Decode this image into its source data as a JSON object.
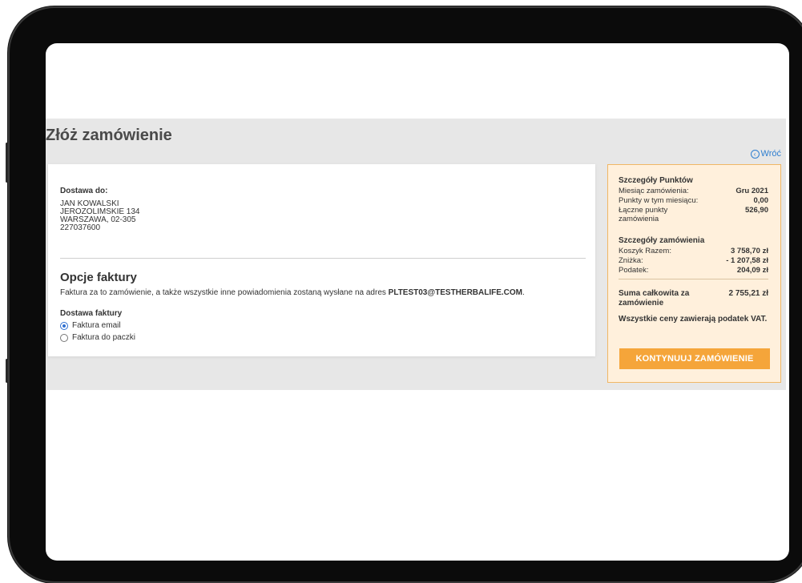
{
  "page": {
    "title": "Złóż zamówienie",
    "back_link": "Wróć"
  },
  "shipping": {
    "title": "Dostawa do:",
    "lines": [
      "JAN KOWALSKI",
      "JEROZOLIMSKIE 134",
      "WARSZAWA, 02-305",
      "227037600"
    ]
  },
  "invoice": {
    "title": "Opcje faktury",
    "description_prefix": "Faktura za to zamówienie, a także wszystkie inne powiadomienia zostaną wysłane na adres",
    "email": "PLTEST03@TESTHERBALIFE.COM",
    "description_suffix": ".",
    "delivery_label": "Dostawa faktury",
    "options": [
      {
        "label": "Faktura email",
        "selected": true
      },
      {
        "label": "Faktura do paczki",
        "selected": false
      }
    ]
  },
  "summary": {
    "points_title": "Szczegóły Punktów",
    "points_rows": [
      {
        "label": "Miesiąc zamówienia:",
        "value": "Gru 2021"
      },
      {
        "label": "Punkty w tym miesiącu:",
        "value": "0,00"
      },
      {
        "label": "Łączne punkty zamówienia",
        "value": "526,90"
      }
    ],
    "order_title": "Szczegóły zamówienia",
    "order_rows": [
      {
        "label": "Koszyk Razem:",
        "value": "3 758,70 zł"
      },
      {
        "label": "Zniżka:",
        "value": "- 1 207,58 zł"
      },
      {
        "label": "Podatek:",
        "value": "204,09 zł"
      }
    ],
    "total_label": "Suma całkowita za zamówienie",
    "total_value": "2 755,21 zł",
    "vat_note": "Wszystkie ceny zawierają podatek VAT.",
    "continue_button": "KONTYNUUJ ZAMÓWIENIE"
  },
  "colors": {
    "accent_orange": "#f5a53a",
    "summary_bg": "#fff0dc",
    "link_blue": "#2f7fd0",
    "page_bg": "#e7e7e7"
  }
}
